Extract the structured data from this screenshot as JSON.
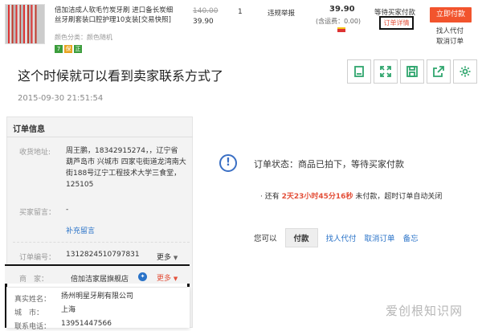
{
  "order": {
    "product_title": "倍加洁成人软毛竹炭牙刷 进口备长炭细丝牙刷套装口腔护理10支装[交易快照]",
    "attr": "颜色分类：颜色随机",
    "badges": [
      "7",
      "保",
      "正"
    ],
    "price_original": "140.00",
    "price_current": "39.90",
    "quantity": "1",
    "report": "违规举报",
    "total": "39.90",
    "shipping": "(含运费：0.00)",
    "status": "等待买家付款",
    "detail_link": "订单详情",
    "pay_button": "立即付款",
    "agent_pay": "找人代付",
    "cancel": "取消订单"
  },
  "caption": "这个时候就可以看到卖家联系方式了",
  "toolbar_icons": [
    "bookmark-icon",
    "expand-icon",
    "save-icon",
    "share-icon",
    "settings-icon"
  ],
  "timestamp": "2015-09-30 21:51:54",
  "info": {
    "title": "订单信息",
    "address_label": "收货地址:",
    "address_value": "周王鹏，18342915274，，辽宁省 葫芦岛市 兴城市 四家屯街道龙湾南大街188号辽宁工程技术大学三食堂，125105",
    "message_label": "买家留言：",
    "message_value": "-",
    "add_message": "补充留言",
    "order_no_label": "订单编号：",
    "order_no": "1312824510797831",
    "more": "更多",
    "seller_label": "商　家：",
    "seller_name": "倍加洁家居旗舰店",
    "seller_more": "更多",
    "real_name_label": "真实姓名：",
    "real_name": "扬州明星牙刷有限公司",
    "city_label": "城　市：",
    "city": "上海",
    "phone_label": "联系电话：",
    "phone": "13951447566"
  },
  "status_area": {
    "status": "订单状态：商品已拍下，等待买家付款",
    "remain_prefix": "· 还有",
    "remain_time": "2天23小时45分16秒",
    "remain_suffix": "未付款，超时订单自动关闭",
    "ops_label": "您可以",
    "pay": "付款",
    "agent": "找人代付",
    "cancel": "取消订单",
    "memo": "备忘"
  },
  "watermark": "爱创根知识网",
  "colors": {
    "accent_orange": "#f2542d",
    "link_blue": "#2a73c8",
    "icon_green": "#2fa56d"
  }
}
